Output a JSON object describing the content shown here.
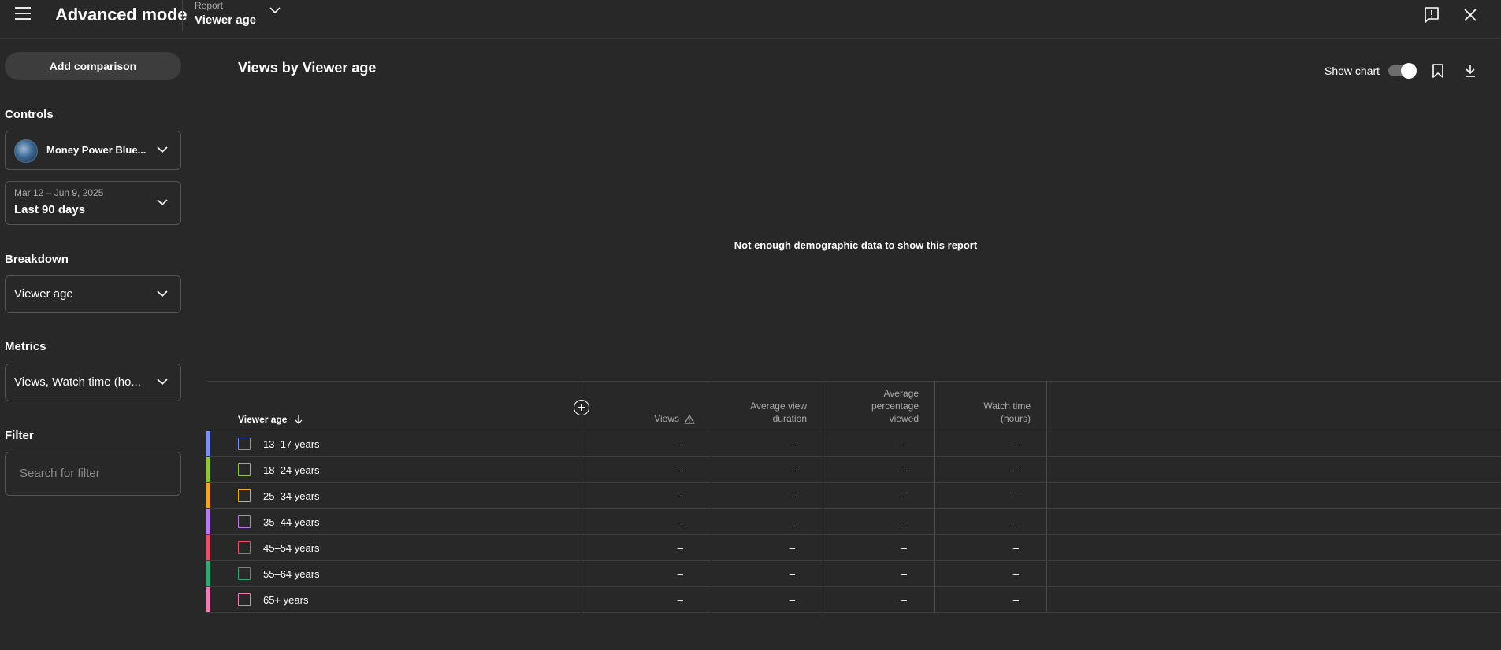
{
  "app": {
    "title": "Advanced mode"
  },
  "report": {
    "label": "Report",
    "value": "Viewer age"
  },
  "sidebar": {
    "add_comparison": "Add comparison",
    "controls_title": "Controls",
    "channel_name": "Money Power Blue...",
    "date_range": "Mar 12 – Jun 9, 2025",
    "date_preset": "Last 90 days",
    "breakdown_title": "Breakdown",
    "breakdown_value": "Viewer age",
    "metrics_title": "Metrics",
    "metrics_value": "Views, Watch time (ho...",
    "filter_title": "Filter",
    "filter_placeholder": "Search for filter"
  },
  "main": {
    "title": "Views by Viewer age",
    "show_chart_label": "Show chart",
    "show_chart_on": true,
    "empty_message": "Not enough demographic data to show this report"
  },
  "table": {
    "first_header": "Viewer age",
    "headers": [
      [
        "Views"
      ],
      [
        "Average view",
        "duration"
      ],
      [
        "Average",
        "percentage",
        "viewed"
      ],
      [
        "Watch time",
        "(hours)"
      ]
    ],
    "rows": [
      {
        "label": "13–17 years",
        "color": "#7c8ff7",
        "values": [
          "–",
          "–",
          "–",
          "–"
        ]
      },
      {
        "label": "18–24 years",
        "color": "#8fc43a",
        "values": [
          "–",
          "–",
          "–",
          "–"
        ]
      },
      {
        "label": "25–34 years",
        "color": "#f3a524",
        "values": [
          "–",
          "–",
          "–",
          "–"
        ]
      },
      {
        "label": "35–44 years",
        "color": "#b97af0",
        "values": [
          "–",
          "–",
          "–",
          "–"
        ]
      },
      {
        "label": "45–54 years",
        "color": "#e8506b",
        "values": [
          "–",
          "–",
          "–",
          "–"
        ]
      },
      {
        "label": "55–64 years",
        "color": "#2fa873",
        "values": [
          "–",
          "–",
          "–",
          "–"
        ]
      },
      {
        "label": "65+ years",
        "color": "#f47ab4",
        "values": [
          "–",
          "–",
          "–",
          "–"
        ]
      }
    ]
  },
  "icons": {
    "menu": "hamburger-menu-icon",
    "chevron": "chevron-down-icon",
    "feedback": "feedback-icon",
    "close": "close-icon",
    "bookmark": "bookmark-icon",
    "download": "download-icon",
    "sort": "arrow-down-icon",
    "warning": "warning-icon",
    "add": "add-circle-icon"
  }
}
